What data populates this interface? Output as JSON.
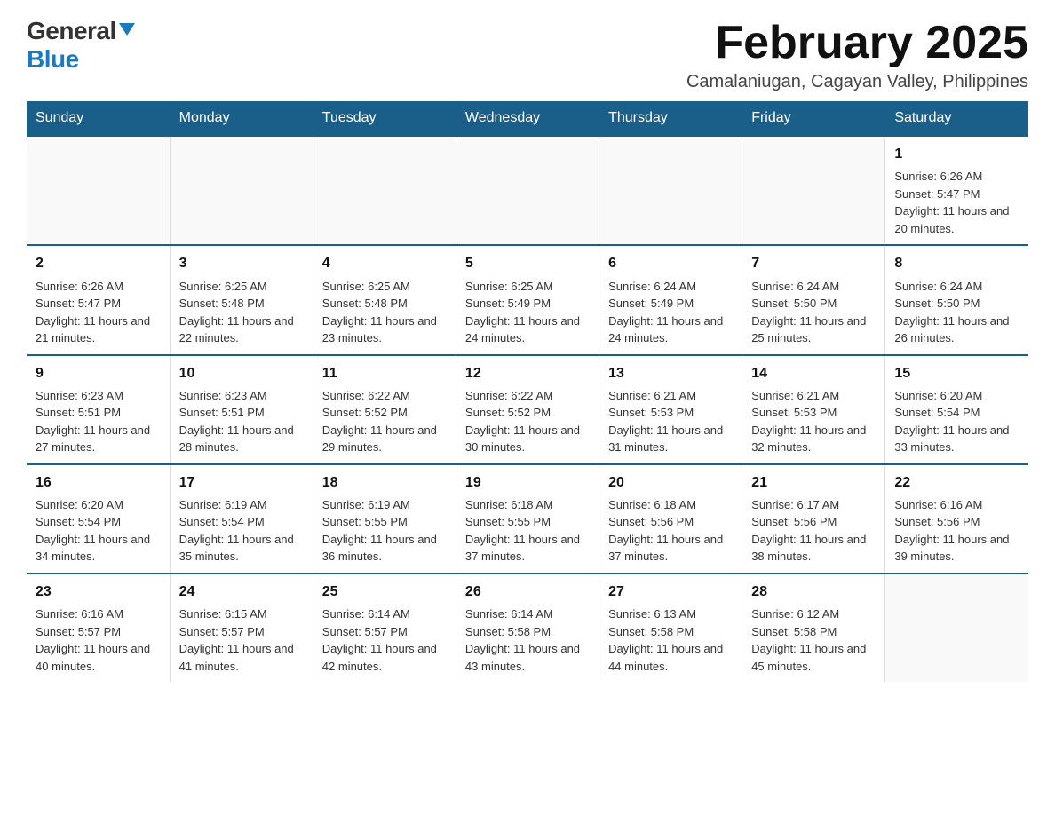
{
  "header": {
    "logo": {
      "general": "General",
      "blue": "Blue"
    },
    "title": "February 2025",
    "location": "Camalaniugan, Cagayan Valley, Philippines"
  },
  "days_of_week": [
    "Sunday",
    "Monday",
    "Tuesday",
    "Wednesday",
    "Thursday",
    "Friday",
    "Saturday"
  ],
  "weeks": [
    {
      "days": [
        {
          "date": "",
          "info": ""
        },
        {
          "date": "",
          "info": ""
        },
        {
          "date": "",
          "info": ""
        },
        {
          "date": "",
          "info": ""
        },
        {
          "date": "",
          "info": ""
        },
        {
          "date": "",
          "info": ""
        },
        {
          "date": "1",
          "info": "Sunrise: 6:26 AM\nSunset: 5:47 PM\nDaylight: 11 hours and 20 minutes."
        }
      ]
    },
    {
      "days": [
        {
          "date": "2",
          "info": "Sunrise: 6:26 AM\nSunset: 5:47 PM\nDaylight: 11 hours and 21 minutes."
        },
        {
          "date": "3",
          "info": "Sunrise: 6:25 AM\nSunset: 5:48 PM\nDaylight: 11 hours and 22 minutes."
        },
        {
          "date": "4",
          "info": "Sunrise: 6:25 AM\nSunset: 5:48 PM\nDaylight: 11 hours and 23 minutes."
        },
        {
          "date": "5",
          "info": "Sunrise: 6:25 AM\nSunset: 5:49 PM\nDaylight: 11 hours and 24 minutes."
        },
        {
          "date": "6",
          "info": "Sunrise: 6:24 AM\nSunset: 5:49 PM\nDaylight: 11 hours and 24 minutes."
        },
        {
          "date": "7",
          "info": "Sunrise: 6:24 AM\nSunset: 5:50 PM\nDaylight: 11 hours and 25 minutes."
        },
        {
          "date": "8",
          "info": "Sunrise: 6:24 AM\nSunset: 5:50 PM\nDaylight: 11 hours and 26 minutes."
        }
      ]
    },
    {
      "days": [
        {
          "date": "9",
          "info": "Sunrise: 6:23 AM\nSunset: 5:51 PM\nDaylight: 11 hours and 27 minutes."
        },
        {
          "date": "10",
          "info": "Sunrise: 6:23 AM\nSunset: 5:51 PM\nDaylight: 11 hours and 28 minutes."
        },
        {
          "date": "11",
          "info": "Sunrise: 6:22 AM\nSunset: 5:52 PM\nDaylight: 11 hours and 29 minutes."
        },
        {
          "date": "12",
          "info": "Sunrise: 6:22 AM\nSunset: 5:52 PM\nDaylight: 11 hours and 30 minutes."
        },
        {
          "date": "13",
          "info": "Sunrise: 6:21 AM\nSunset: 5:53 PM\nDaylight: 11 hours and 31 minutes."
        },
        {
          "date": "14",
          "info": "Sunrise: 6:21 AM\nSunset: 5:53 PM\nDaylight: 11 hours and 32 minutes."
        },
        {
          "date": "15",
          "info": "Sunrise: 6:20 AM\nSunset: 5:54 PM\nDaylight: 11 hours and 33 minutes."
        }
      ]
    },
    {
      "days": [
        {
          "date": "16",
          "info": "Sunrise: 6:20 AM\nSunset: 5:54 PM\nDaylight: 11 hours and 34 minutes."
        },
        {
          "date": "17",
          "info": "Sunrise: 6:19 AM\nSunset: 5:54 PM\nDaylight: 11 hours and 35 minutes."
        },
        {
          "date": "18",
          "info": "Sunrise: 6:19 AM\nSunset: 5:55 PM\nDaylight: 11 hours and 36 minutes."
        },
        {
          "date": "19",
          "info": "Sunrise: 6:18 AM\nSunset: 5:55 PM\nDaylight: 11 hours and 37 minutes."
        },
        {
          "date": "20",
          "info": "Sunrise: 6:18 AM\nSunset: 5:56 PM\nDaylight: 11 hours and 37 minutes."
        },
        {
          "date": "21",
          "info": "Sunrise: 6:17 AM\nSunset: 5:56 PM\nDaylight: 11 hours and 38 minutes."
        },
        {
          "date": "22",
          "info": "Sunrise: 6:16 AM\nSunset: 5:56 PM\nDaylight: 11 hours and 39 minutes."
        }
      ]
    },
    {
      "days": [
        {
          "date": "23",
          "info": "Sunrise: 6:16 AM\nSunset: 5:57 PM\nDaylight: 11 hours and 40 minutes."
        },
        {
          "date": "24",
          "info": "Sunrise: 6:15 AM\nSunset: 5:57 PM\nDaylight: 11 hours and 41 minutes."
        },
        {
          "date": "25",
          "info": "Sunrise: 6:14 AM\nSunset: 5:57 PM\nDaylight: 11 hours and 42 minutes."
        },
        {
          "date": "26",
          "info": "Sunrise: 6:14 AM\nSunset: 5:58 PM\nDaylight: 11 hours and 43 minutes."
        },
        {
          "date": "27",
          "info": "Sunrise: 6:13 AM\nSunset: 5:58 PM\nDaylight: 11 hours and 44 minutes."
        },
        {
          "date": "28",
          "info": "Sunrise: 6:12 AM\nSunset: 5:58 PM\nDaylight: 11 hours and 45 minutes."
        },
        {
          "date": "",
          "info": ""
        }
      ]
    }
  ]
}
